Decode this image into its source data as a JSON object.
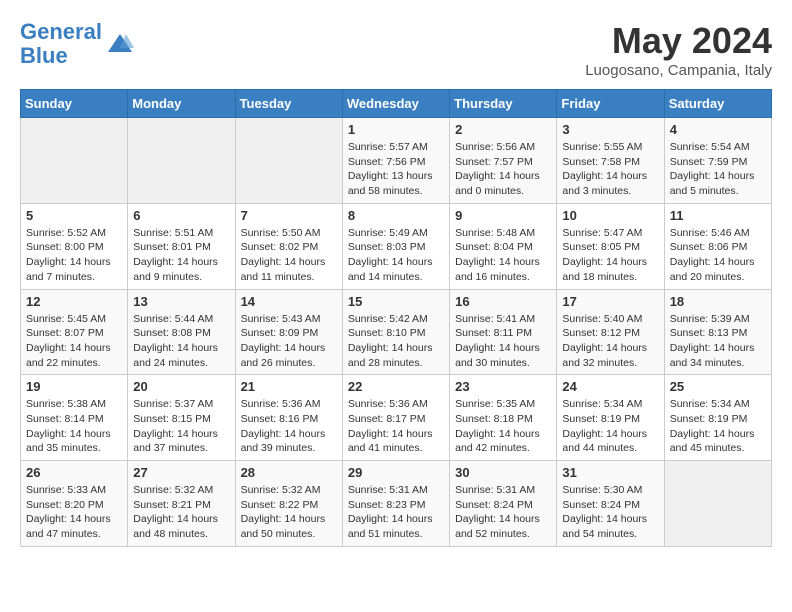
{
  "header": {
    "logo_line1": "General",
    "logo_line2": "Blue",
    "month": "May 2024",
    "location": "Luogosano, Campania, Italy"
  },
  "weekdays": [
    "Sunday",
    "Monday",
    "Tuesday",
    "Wednesday",
    "Thursday",
    "Friday",
    "Saturday"
  ],
  "weeks": [
    [
      {
        "day": "",
        "info": ""
      },
      {
        "day": "",
        "info": ""
      },
      {
        "day": "",
        "info": ""
      },
      {
        "day": "1",
        "info": "Sunrise: 5:57 AM\nSunset: 7:56 PM\nDaylight: 13 hours\nand 58 minutes."
      },
      {
        "day": "2",
        "info": "Sunrise: 5:56 AM\nSunset: 7:57 PM\nDaylight: 14 hours\nand 0 minutes."
      },
      {
        "day": "3",
        "info": "Sunrise: 5:55 AM\nSunset: 7:58 PM\nDaylight: 14 hours\nand 3 minutes."
      },
      {
        "day": "4",
        "info": "Sunrise: 5:54 AM\nSunset: 7:59 PM\nDaylight: 14 hours\nand 5 minutes."
      }
    ],
    [
      {
        "day": "5",
        "info": "Sunrise: 5:52 AM\nSunset: 8:00 PM\nDaylight: 14 hours\nand 7 minutes."
      },
      {
        "day": "6",
        "info": "Sunrise: 5:51 AM\nSunset: 8:01 PM\nDaylight: 14 hours\nand 9 minutes."
      },
      {
        "day": "7",
        "info": "Sunrise: 5:50 AM\nSunset: 8:02 PM\nDaylight: 14 hours\nand 11 minutes."
      },
      {
        "day": "8",
        "info": "Sunrise: 5:49 AM\nSunset: 8:03 PM\nDaylight: 14 hours\nand 14 minutes."
      },
      {
        "day": "9",
        "info": "Sunrise: 5:48 AM\nSunset: 8:04 PM\nDaylight: 14 hours\nand 16 minutes."
      },
      {
        "day": "10",
        "info": "Sunrise: 5:47 AM\nSunset: 8:05 PM\nDaylight: 14 hours\nand 18 minutes."
      },
      {
        "day": "11",
        "info": "Sunrise: 5:46 AM\nSunset: 8:06 PM\nDaylight: 14 hours\nand 20 minutes."
      }
    ],
    [
      {
        "day": "12",
        "info": "Sunrise: 5:45 AM\nSunset: 8:07 PM\nDaylight: 14 hours\nand 22 minutes."
      },
      {
        "day": "13",
        "info": "Sunrise: 5:44 AM\nSunset: 8:08 PM\nDaylight: 14 hours\nand 24 minutes."
      },
      {
        "day": "14",
        "info": "Sunrise: 5:43 AM\nSunset: 8:09 PM\nDaylight: 14 hours\nand 26 minutes."
      },
      {
        "day": "15",
        "info": "Sunrise: 5:42 AM\nSunset: 8:10 PM\nDaylight: 14 hours\nand 28 minutes."
      },
      {
        "day": "16",
        "info": "Sunrise: 5:41 AM\nSunset: 8:11 PM\nDaylight: 14 hours\nand 30 minutes."
      },
      {
        "day": "17",
        "info": "Sunrise: 5:40 AM\nSunset: 8:12 PM\nDaylight: 14 hours\nand 32 minutes."
      },
      {
        "day": "18",
        "info": "Sunrise: 5:39 AM\nSunset: 8:13 PM\nDaylight: 14 hours\nand 34 minutes."
      }
    ],
    [
      {
        "day": "19",
        "info": "Sunrise: 5:38 AM\nSunset: 8:14 PM\nDaylight: 14 hours\nand 35 minutes."
      },
      {
        "day": "20",
        "info": "Sunrise: 5:37 AM\nSunset: 8:15 PM\nDaylight: 14 hours\nand 37 minutes."
      },
      {
        "day": "21",
        "info": "Sunrise: 5:36 AM\nSunset: 8:16 PM\nDaylight: 14 hours\nand 39 minutes."
      },
      {
        "day": "22",
        "info": "Sunrise: 5:36 AM\nSunset: 8:17 PM\nDaylight: 14 hours\nand 41 minutes."
      },
      {
        "day": "23",
        "info": "Sunrise: 5:35 AM\nSunset: 8:18 PM\nDaylight: 14 hours\nand 42 minutes."
      },
      {
        "day": "24",
        "info": "Sunrise: 5:34 AM\nSunset: 8:19 PM\nDaylight: 14 hours\nand 44 minutes."
      },
      {
        "day": "25",
        "info": "Sunrise: 5:34 AM\nSunset: 8:19 PM\nDaylight: 14 hours\nand 45 minutes."
      }
    ],
    [
      {
        "day": "26",
        "info": "Sunrise: 5:33 AM\nSunset: 8:20 PM\nDaylight: 14 hours\nand 47 minutes."
      },
      {
        "day": "27",
        "info": "Sunrise: 5:32 AM\nSunset: 8:21 PM\nDaylight: 14 hours\nand 48 minutes."
      },
      {
        "day": "28",
        "info": "Sunrise: 5:32 AM\nSunset: 8:22 PM\nDaylight: 14 hours\nand 50 minutes."
      },
      {
        "day": "29",
        "info": "Sunrise: 5:31 AM\nSunset: 8:23 PM\nDaylight: 14 hours\nand 51 minutes."
      },
      {
        "day": "30",
        "info": "Sunrise: 5:31 AM\nSunset: 8:24 PM\nDaylight: 14 hours\nand 52 minutes."
      },
      {
        "day": "31",
        "info": "Sunrise: 5:30 AM\nSunset: 8:24 PM\nDaylight: 14 hours\nand 54 minutes."
      },
      {
        "day": "",
        "info": ""
      }
    ]
  ]
}
